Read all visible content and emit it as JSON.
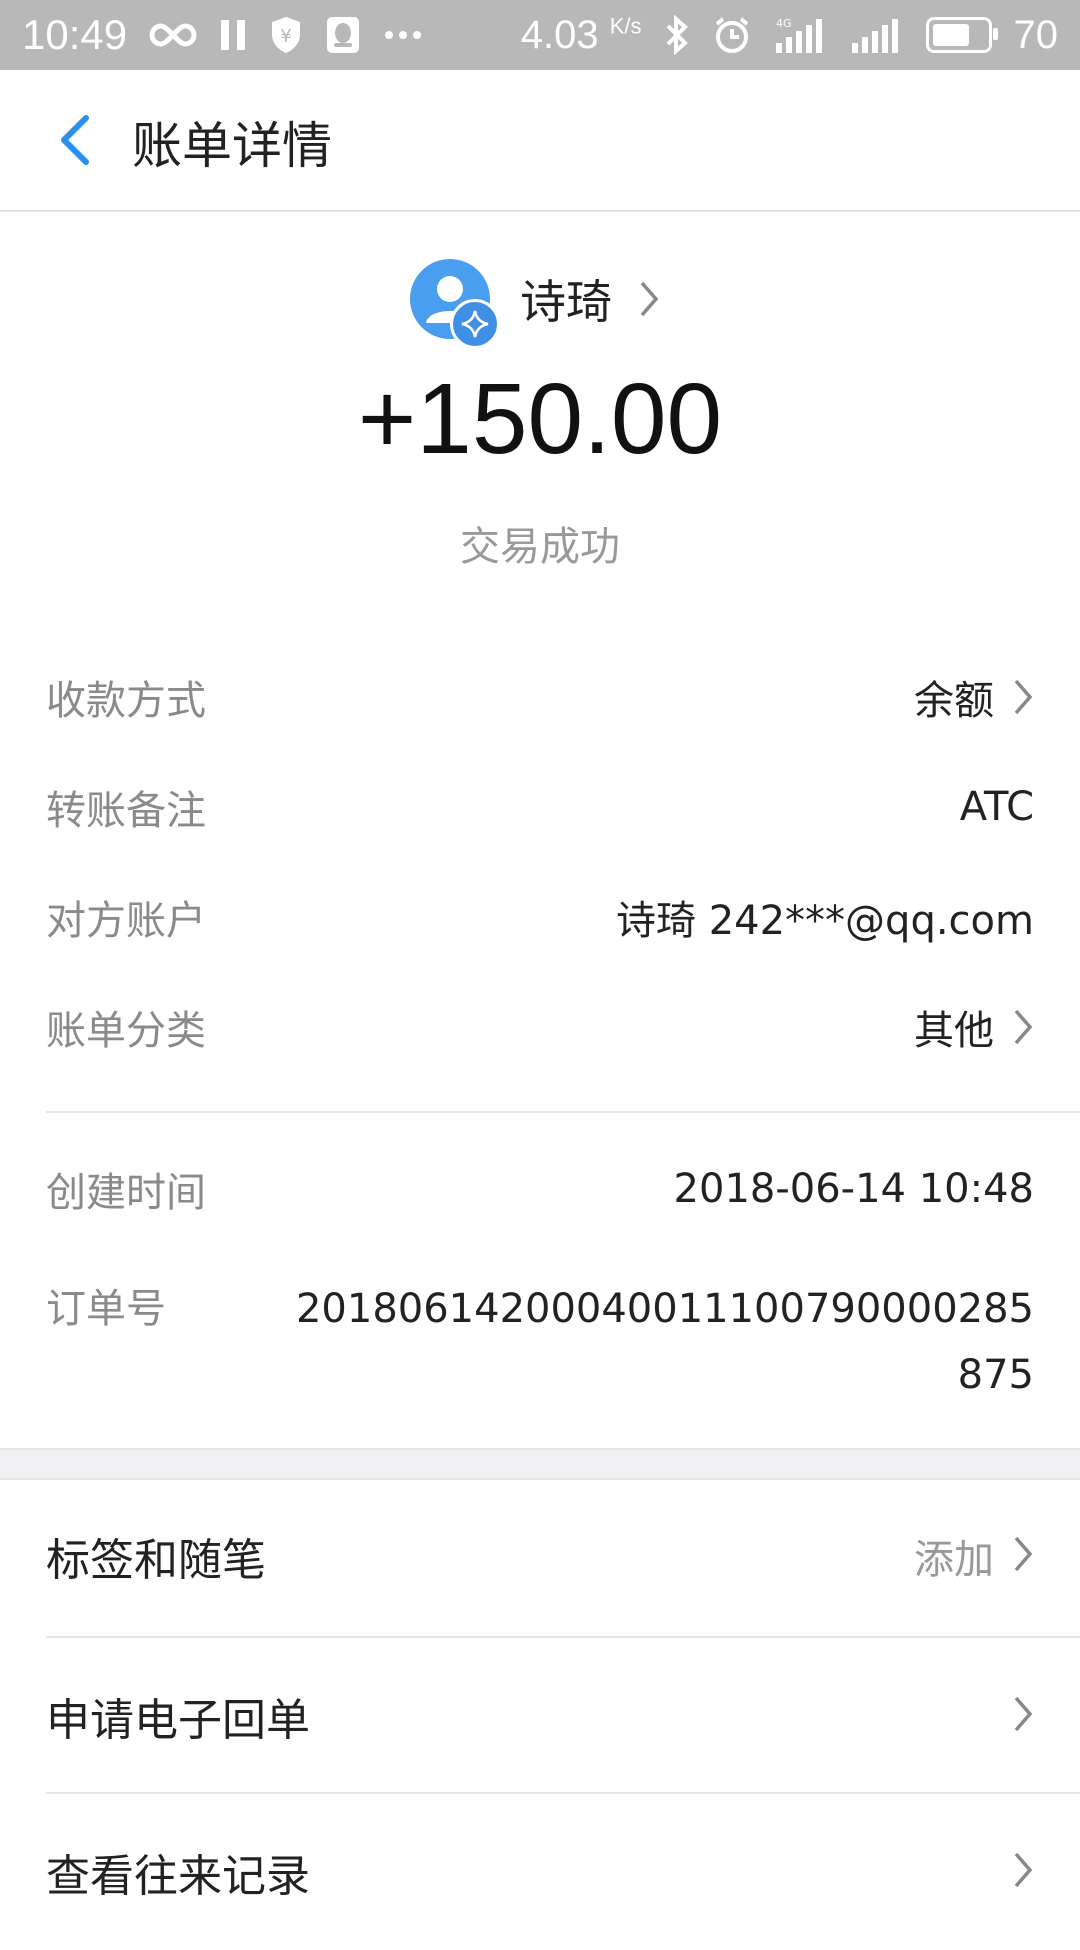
{
  "status_bar": {
    "time": "10:49",
    "net_speed": "4.03",
    "net_speed_unit": "K/s",
    "battery": "70",
    "battery_level": 0.7,
    "icons": [
      "infinity-icon",
      "pause-icon",
      "shield-yen-icon",
      "qq-icon",
      "more-dots-icon",
      "bluetooth-icon",
      "alarm-icon",
      "signal-4g-icon",
      "signal-icon",
      "battery-icon"
    ]
  },
  "header": {
    "title": "账单详情",
    "back_icon": "back-arrow-icon"
  },
  "summary": {
    "payer_name": "诗琦",
    "amount": "+150.00",
    "status": "交易成功"
  },
  "details": [
    {
      "label": "收款方式",
      "value": "余额"
    },
    {
      "label": "转账备注",
      "value": "ATC"
    },
    {
      "label": "对方账户",
      "value": "诗琦 242***@qq.com"
    },
    {
      "label": "账单分类",
      "value": "其他"
    },
    {
      "label": "创建时间",
      "value": "2018-06-14 10:48"
    },
    {
      "label": "订单号",
      "value": "20180614200040011100790000285875"
    }
  ],
  "menu": [
    {
      "label": "标签和随笔",
      "hint": "添加"
    },
    {
      "label": "申请电子回单"
    },
    {
      "label": "查看往来记录"
    }
  ],
  "colors": {
    "accent": "#2b8ee8",
    "status_bar": "#b8b8b8",
    "label_gray": "#8a8a8a"
  }
}
